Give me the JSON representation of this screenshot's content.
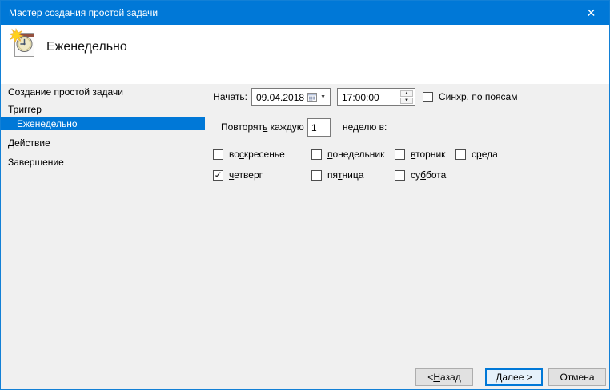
{
  "window": {
    "title": "Мастер создания простой задачи"
  },
  "header": {
    "title": "Еженедельно",
    "icon": "task-scheduler-wizard-icon"
  },
  "sidebar": {
    "items": [
      {
        "label": "Создание простой задачи",
        "selected": false
      },
      {
        "label": "Триггер",
        "selected": false
      },
      {
        "label": "Еженедельно",
        "selected": true
      },
      {
        "label": "Действие",
        "selected": false
      },
      {
        "label": "Завершение",
        "selected": false
      }
    ]
  },
  "main": {
    "start_label": {
      "label": "Начать:",
      "u": 1
    },
    "date_value": "09.04.2018",
    "time_value": "17:00:00",
    "sync_checkbox": {
      "label": "Синхр. по поясам",
      "u": 3,
      "checked": false
    },
    "repeat_label": {
      "label": "Повторять каждую",
      "u": 8
    },
    "repeat_value": "1",
    "repeat_suffix": "неделю в:",
    "weekdays": [
      {
        "label": "воскресенье",
        "u": 2,
        "checked": false
      },
      {
        "label": "понедельник",
        "u": 0,
        "checked": false
      },
      {
        "label": "вторник",
        "u": 0,
        "checked": false
      },
      {
        "label": "среда",
        "u": 1,
        "checked": false
      },
      {
        "label": "четверг",
        "u": 0,
        "checked": true
      },
      {
        "label": "пятница",
        "u": 2,
        "checked": false
      },
      {
        "label": "суббота",
        "u": 2,
        "checked": false
      }
    ]
  },
  "footer": {
    "back": {
      "label": "< Назад",
      "u": 2
    },
    "next": {
      "label": "Далее >",
      "u": 0
    },
    "cancel": {
      "label": "Отмена",
      "u": -1
    }
  },
  "glyphs": {
    "close": "✕",
    "check": "✓",
    "combo_arrow": "▼",
    "spin_up": "▲",
    "spin_down": "▼"
  },
  "colors": {
    "accent": "#0078d7",
    "titlebar_bg": "#0078d7",
    "header_bg": "#ffffff",
    "body_bg": "#f0f0f0",
    "selected_item_bg": "#0078d7",
    "button_bg": "#e1e1e1",
    "button_border": "#adadad",
    "default_button_bg": "#e5f1fb",
    "field_border": "#7a7a7a"
  }
}
